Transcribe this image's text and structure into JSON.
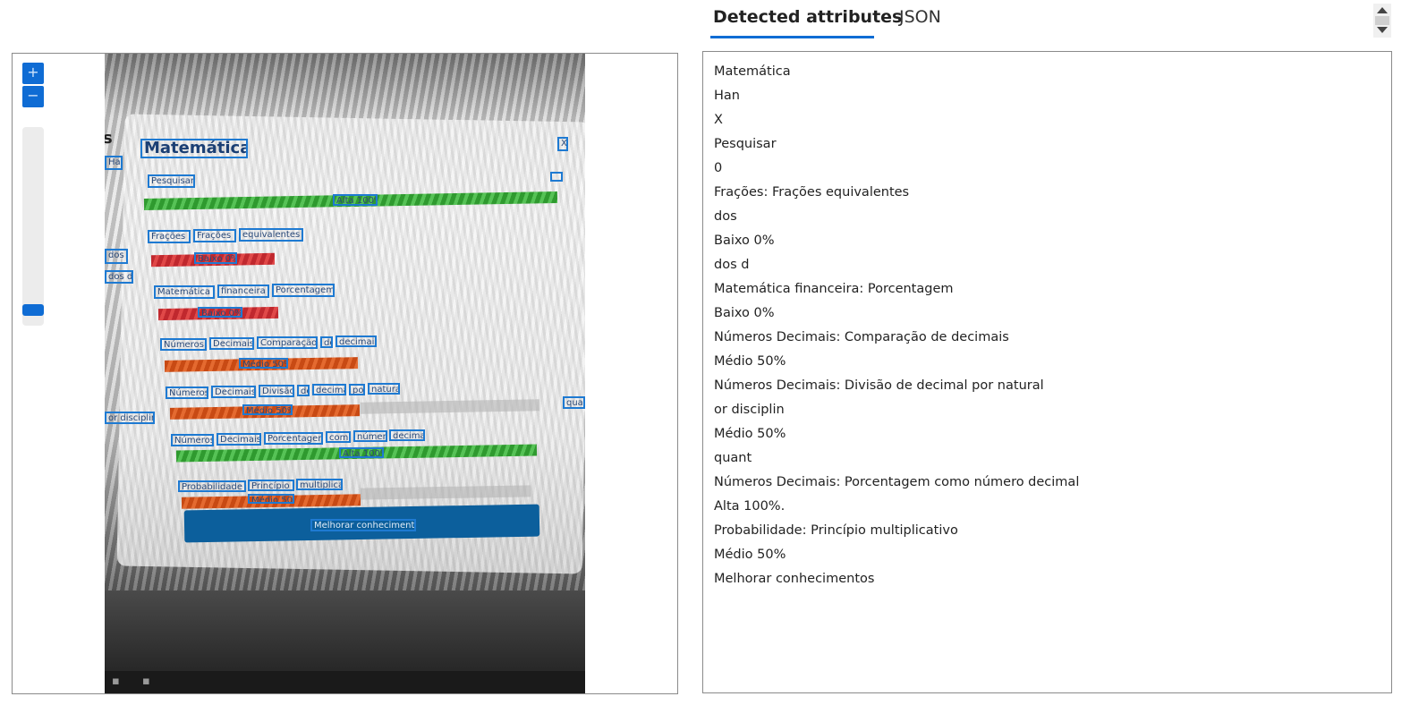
{
  "tabs": {
    "detected": "Detected attributes",
    "json": "JSON"
  },
  "zoom": {
    "in": "+",
    "out": "−"
  },
  "attributes": [
    "Matemática",
    "Han",
    "X",
    "Pesquisar",
    "0",
    "Frações: Frações equivalentes",
    "dos",
    "Baixo 0%",
    "dos d",
    "Matemática financeira: Porcentagem",
    "Baixo 0%",
    "Números Decimais: Comparação de decimais",
    "Médio 50%",
    "Números Decimais: Divisão de decimal por natural",
    "or disciplin",
    "Médio 50%",
    "quant",
    "Números Decimais: Porcentagem como número decimal",
    "Alta 100%.",
    "Probabilidade: Princípio multiplicativo",
    "Médio 50%",
    "Melhorar conhecimentos"
  ],
  "photo": {
    "title": "Matemática",
    "search": "Pesquisar",
    "bar0_label": "Alta 100%",
    "row1": [
      "Frações",
      "Frações",
      "equivalentes"
    ],
    "row1_bar": "Baixo 0%",
    "row2": [
      "Matemática",
      "financeira",
      "Porcentagem"
    ],
    "row2_bar": "Baixo 0%",
    "row3": [
      "Números",
      "Decimais",
      "Comparação",
      "de",
      "decimais"
    ],
    "row3_bar": "Médio 50%",
    "row4": [
      "Números",
      "Decimais",
      "Divisão",
      "de",
      "decimal",
      "por",
      "natural"
    ],
    "row4_bar": "Médio 50%",
    "row5": [
      "Números",
      "Decimais",
      "Porcentagem",
      "como",
      "número",
      "decimal"
    ],
    "row5_bar": "Alta 100%",
    "row6": [
      "Probabilidade",
      "Princípio",
      "multiplicativo"
    ],
    "row6_bar": "Médio 50%",
    "button": "Melhorar conhecimentos",
    "side_labels": [
      "s",
      "Han",
      "dos",
      "dos d",
      "or disciplin",
      "quant"
    ],
    "close": "X"
  }
}
